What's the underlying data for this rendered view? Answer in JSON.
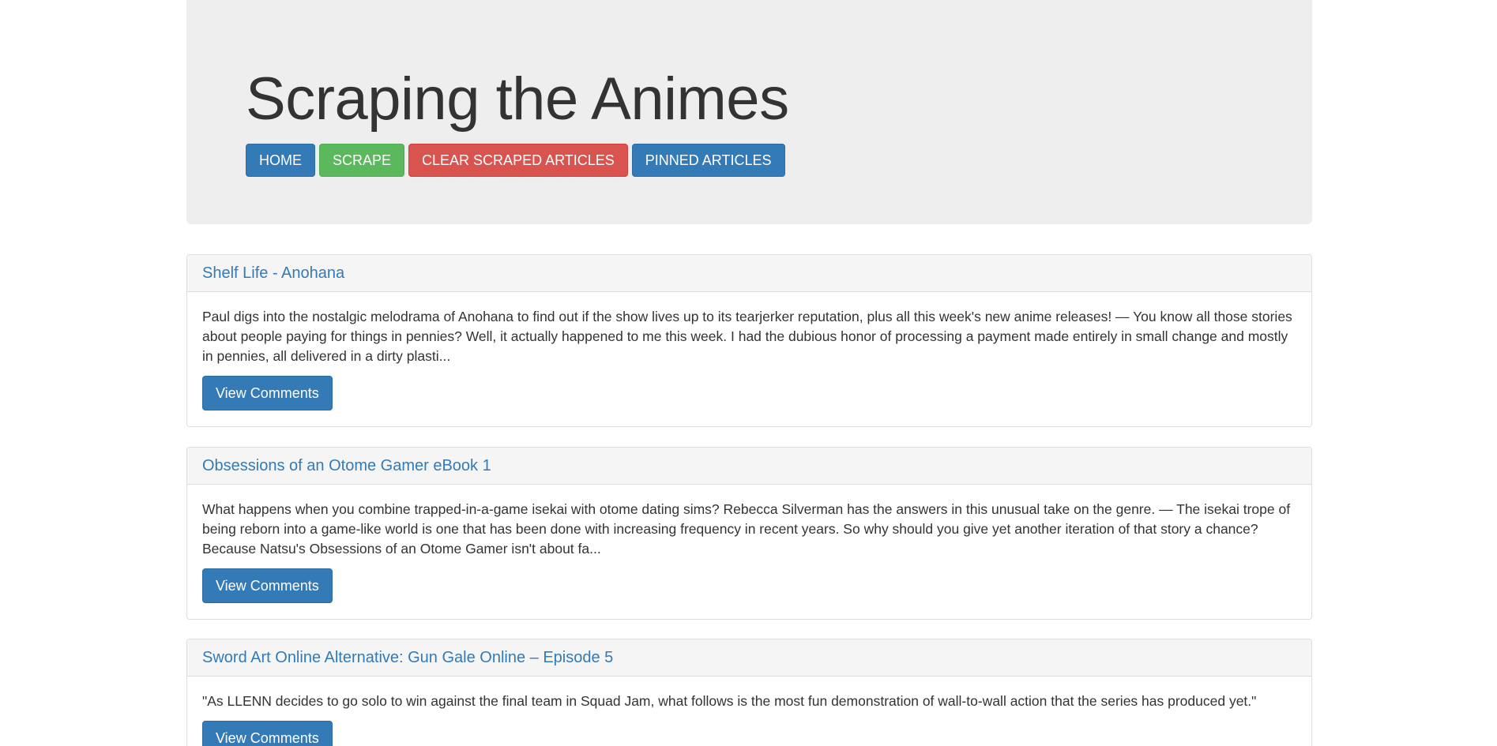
{
  "header": {
    "title": "Scraping the Animes",
    "buttons": {
      "home": "HOME",
      "scrape": "SCRAPE",
      "clear": "CLEAR SCRAPED ARTICLES",
      "pinned": "PINNED ARTICLES"
    }
  },
  "articles": [
    {
      "title": "Shelf Life - Anohana",
      "summary": "Paul digs into the nostalgic melodrama of Anohana to find out if the show lives up to its tearjerker reputation, plus all this week's new anime releases! — You know all those stories about people paying for things in pennies? Well, it actually happened to me this week. I had the dubious honor of processing a payment made entirely in small change and mostly in pennies, all delivered in a dirty plasti...",
      "button": "View Comments"
    },
    {
      "title": "Obsessions of an Otome Gamer eBook 1",
      "summary": "What happens when you combine trapped-in-a-game isekai with otome dating sims? Rebecca Silverman has the answers in this unusual take on the genre. — The isekai trope of being reborn into a game-like world is one that has been done with increasing frequency in recent years. So why should you give yet another iteration of that story a chance? Because Natsu's Obsessions of an Otome Gamer isn't about fa...",
      "button": "View Comments"
    },
    {
      "title": "Sword Art Online Alternative: Gun Gale Online – Episode 5",
      "summary": "\"As LLENN decides to go solo to win against the final team in Squad Jam, what follows is the most fun demonstration of wall-to-wall action that the series has produced yet.\"",
      "button": "View Comments"
    }
  ]
}
